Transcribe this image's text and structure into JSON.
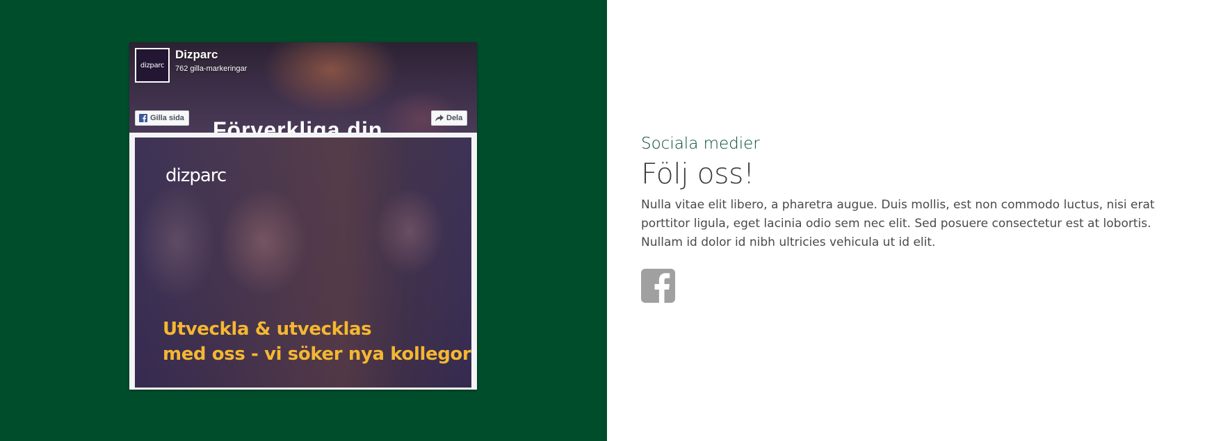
{
  "facebook_widget": {
    "page_name": "Dizparc",
    "likes_text": "762 gilla-markeringar",
    "logo_text": "dizparc",
    "cover_bleed_text": "Förverkliga din",
    "like_button_label": "Gilla sida",
    "share_button_label": "Dela",
    "post": {
      "logo_text": "dizparc",
      "headline_line1": "Utveckla & utvecklas",
      "headline_line2": "med oss - vi söker nya kollegor!"
    }
  },
  "section": {
    "eyebrow": "Sociala medier",
    "heading": "Följ oss!",
    "body": "Nulla vitae elit libero, a pharetra augue. Duis mollis, est non commodo luctus, nisi erat porttitor ligula, eget lacinia odio sem nec elit. Sed posuere consectetur est at lobortis. Nullam id dolor id nibh ultricies vehicula ut id elit."
  },
  "social_links": [
    {
      "icon": "facebook-icon",
      "color": "#a0a0a0"
    }
  ],
  "colors": {
    "left_panel_background": "#004d2c",
    "eyebrow_text": "#004d2c",
    "headline_accent": "#f5b731"
  }
}
